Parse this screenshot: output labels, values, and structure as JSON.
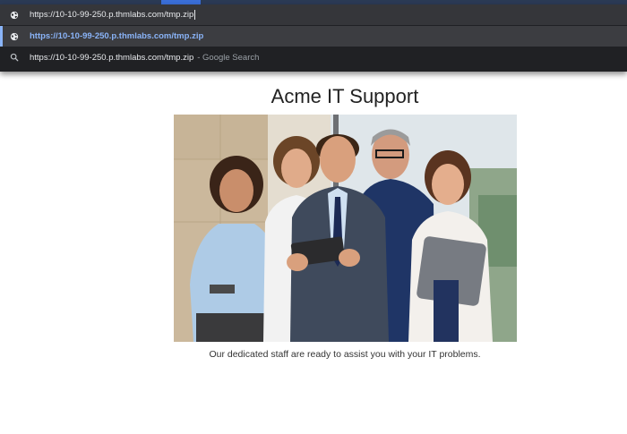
{
  "browser": {
    "omnibox": {
      "input_value": "https://10-10-99-250.p.thmlabs.com/tmp.zip",
      "suggestions": [
        {
          "type": "url",
          "text": "https://10-10-99-250.p.thmlabs.com/tmp.zip",
          "icon": "globe-icon"
        },
        {
          "type": "search",
          "text": "https://10-10-99-250.p.thmlabs.com/tmp.zip",
          "suffix": "- Google Search",
          "icon": "search-icon"
        }
      ]
    },
    "colors": {
      "panel_bg": "#202124",
      "selected_bg": "#3c3d41",
      "accent": "#8ab4f8"
    }
  },
  "site": {
    "title": "Acme IT Support",
    "hero_image": "team-photo",
    "caption": "Our dedicated staff are ready to assist you with your IT problems."
  }
}
